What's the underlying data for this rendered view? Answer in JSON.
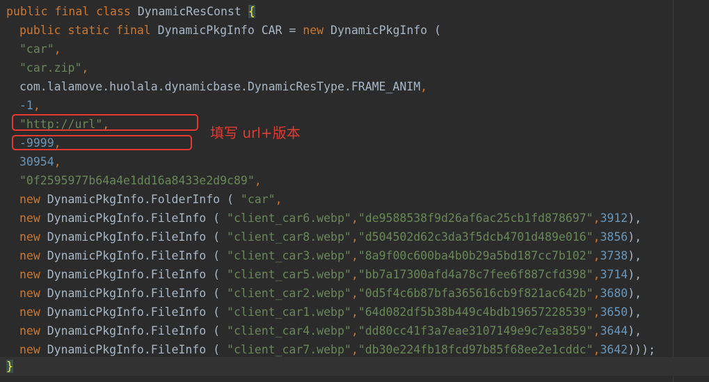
{
  "code": {
    "l1": {
      "kw": "public final class",
      "name": " DynamicResConst ",
      "brace": "{"
    },
    "l2": {
      "kw1": "public static final",
      "t1": " DynamicPkgInfo CAR = ",
      "kw2": "new",
      "t2": " DynamicPkgInfo ("
    },
    "l3": {
      "s": "\"car\"",
      "c": ","
    },
    "l4": {
      "s": "\"car.zip\"",
      "c": ","
    },
    "l5": {
      "t": "com.lalamove.huolala.dynamicbase.DynamicResType.FRAME_ANIM",
      "c": ","
    },
    "l6": {
      "n": "-1",
      "c": ","
    },
    "l7": {
      "s": "\"http://url\"",
      "c": ","
    },
    "l8": {
      "n": "-9999",
      "c": ","
    },
    "l9": {
      "n": "30954",
      "c": ","
    },
    "l10": {
      "s": "\"0f2595977b64a4e1dd16a8433e2d9c89\"",
      "c": ","
    },
    "l11": {
      "kw": "new",
      "t": " DynamicPkgInfo.FolderInfo ( ",
      "s": "\"car\"",
      "c": ","
    },
    "files": [
      {
        "kw": "new",
        "t": " DynamicPkgInfo.FileInfo ( ",
        "name": "\"client_car6.webp\"",
        "sep": ",",
        "hash": "\"de9588538f9d26af6ac25cb1fd878697\"",
        "sep2": ",",
        "size": "3912",
        "end": "),"
      },
      {
        "kw": "new",
        "t": " DynamicPkgInfo.FileInfo ( ",
        "name": "\"client_car8.webp\"",
        "sep": ",",
        "hash": "\"d504502d62c3da3f5dcb4701d489e016\"",
        "sep2": ",",
        "size": "3856",
        "end": "),"
      },
      {
        "kw": "new",
        "t": " DynamicPkgInfo.FileInfo ( ",
        "name": "\"client_car3.webp\"",
        "sep": ",",
        "hash": "\"8a9f00c600ba4b0b29a5bd187cc7b102\"",
        "sep2": ",",
        "size": "3738",
        "end": "),"
      },
      {
        "kw": "new",
        "t": " DynamicPkgInfo.FileInfo ( ",
        "name": "\"client_car5.webp\"",
        "sep": ",",
        "hash": "\"bb7a17300afd4a78c7fee6f887cfd398\"",
        "sep2": ",",
        "size": "3714",
        "end": "),"
      },
      {
        "kw": "new",
        "t": " DynamicPkgInfo.FileInfo ( ",
        "name": "\"client_car2.webp\"",
        "sep": ",",
        "hash": "\"0d5f4c6b87bfa365616cb9f821ac642b\"",
        "sep2": ",",
        "size": "3680",
        "end": "),"
      },
      {
        "kw": "new",
        "t": " DynamicPkgInfo.FileInfo ( ",
        "name": "\"client_car1.webp\"",
        "sep": ",",
        "hash": "\"64d082df5b38b449c4bdb19657228539\"",
        "sep2": ",",
        "size": "3650",
        "end": "),"
      },
      {
        "kw": "new",
        "t": " DynamicPkgInfo.FileInfo ( ",
        "name": "\"client_car4.webp\"",
        "sep": ",",
        "hash": "\"dd80cc41f3a7eae3107149e9c7ea3859\"",
        "sep2": ",",
        "size": "3644",
        "end": "),"
      },
      {
        "kw": "new",
        "t": " DynamicPkgInfo.FileInfo ( ",
        "name": "\"client_car7.webp\"",
        "sep": ",",
        "hash": "\"db30e224fb18fcd97b85f68ee2e1cddc\"",
        "sep2": ",",
        "size": "3642",
        "end": ")));"
      }
    ],
    "closing": "}"
  },
  "annotation": {
    "text": "填写 url+版本"
  },
  "colors": {
    "background": "#2b2b2b",
    "keyword": "#cc7832",
    "string": "#6a8759",
    "number": "#6897bb",
    "plain": "#a9b7c6",
    "annotation": "#e6392f"
  }
}
